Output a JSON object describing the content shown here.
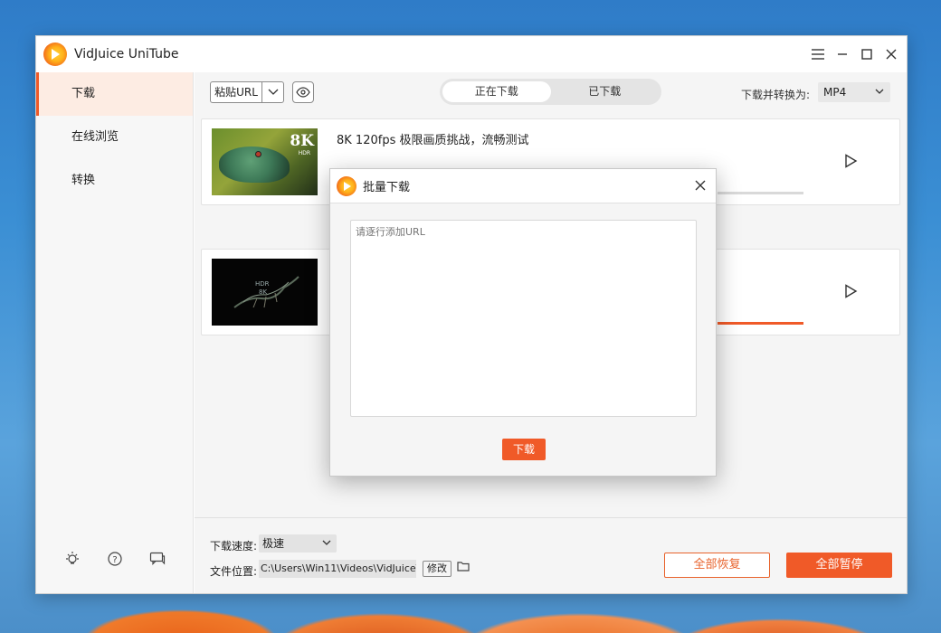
{
  "app": {
    "title": "VidJuice UniTube"
  },
  "sidebar": {
    "items": [
      {
        "label": "下载",
        "active": true
      },
      {
        "label": "在线浏览",
        "active": false
      },
      {
        "label": "转换",
        "active": false
      }
    ],
    "bottom_icons": [
      "bulb-icon",
      "help-icon",
      "feedback-icon"
    ]
  },
  "toolbar": {
    "paste_url_label": "粘贴URL",
    "tabs": [
      {
        "label": "正在下载",
        "active": true
      },
      {
        "label": "已下载",
        "active": false
      }
    ],
    "convert_label": "下载并转换为:",
    "format_value": "MP4"
  },
  "downloads": [
    {
      "title": "8K 120fps 极限画质挑战，流畅测试",
      "thumb_badge": "8K",
      "thumb_badge_sub": "HDR",
      "progress_color": "#d9d9d9"
    },
    {
      "title": "",
      "thumb_badge": "HDR",
      "thumb_badge_sub": "8K",
      "progress_color": "#f05a28"
    }
  ],
  "footer": {
    "speed_label": "下载速度:",
    "speed_value": "极速",
    "location_label": "文件位置:",
    "location_value": "C:\\Users\\Win11\\Videos\\VidJuice\\",
    "change_label": "修改",
    "resume_all_label": "全部恢复",
    "pause_all_label": "全部暂停"
  },
  "dialog": {
    "title": "批量下载",
    "placeholder": "请逐行添加URL",
    "download_label": "下载"
  },
  "colors": {
    "accent": "#f05a28",
    "sidebar_active_bg": "#fdece3"
  }
}
